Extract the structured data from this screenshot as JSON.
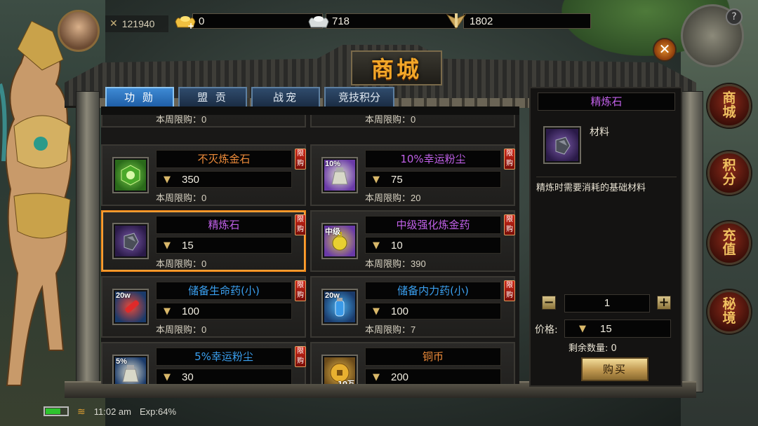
{
  "player": {
    "power": "121940"
  },
  "currencies": [
    {
      "icon": "gold-ingot-icon",
      "value": "0"
    },
    {
      "icon": "silver-ingot-icon",
      "value": "718"
    },
    {
      "icon": "trophy-icon",
      "value": "1802"
    }
  ],
  "window": {
    "title": "商城"
  },
  "side_buttons": [
    "商城",
    "积分",
    "充值",
    "秘境"
  ],
  "tabs": [
    {
      "label": "功 勋",
      "active": true
    },
    {
      "label": "盟 贡",
      "active": false
    },
    {
      "label": "战宠",
      "active": false
    },
    {
      "label": "竞技积分",
      "active": false
    }
  ],
  "limit_badge": "限购",
  "weekly_label": "本周限购：",
  "items": [
    {
      "name": "",
      "price": "",
      "weekly": "0",
      "partial": true
    },
    {
      "name": "",
      "price": "",
      "weekly": "0",
      "partial": true
    },
    {
      "name": "不灭炼金石",
      "price": "350",
      "weekly": "0",
      "color": "orange",
      "icon": "alchemy-stone-icon",
      "tag": ""
    },
    {
      "name": "10%幸运粉尘",
      "price": "75",
      "weekly": "20",
      "color": "purple",
      "icon": "luck-dust-icon",
      "tag": "10%"
    },
    {
      "name": "精炼石",
      "price": "15",
      "weekly": "0",
      "color": "purple",
      "icon": "refining-stone-icon",
      "tag": "",
      "selected": true
    },
    {
      "name": "中级强化炼金药",
      "price": "10",
      "weekly": "390",
      "color": "purple",
      "icon": "potion-flask-icon",
      "tag": "中级"
    },
    {
      "name": "储备生命药(小)",
      "price": "100",
      "weekly": "0",
      "color": "blue",
      "icon": "health-potion-icon",
      "tag": "20w"
    },
    {
      "name": "储备内力药(小)",
      "price": "100",
      "weekly": "7",
      "color": "blue",
      "icon": "mana-potion-icon",
      "tag": "20w"
    },
    {
      "name": "5%幸运粉尘",
      "price": "30",
      "weekly": "",
      "color": "blue",
      "icon": "luck-dust-icon",
      "tag": "5%"
    },
    {
      "name": "铜币",
      "price": "200",
      "weekly": "",
      "color": "orange",
      "icon": "copper-coin-icon",
      "tag_b": "10万"
    }
  ],
  "detail": {
    "title": "精炼石",
    "type": "材料",
    "description": "精炼时需要消耗的基础材料",
    "quantity": "1",
    "price_label": "价格:",
    "price": "15",
    "remaining_label": "剩余数量:",
    "remaining": "0",
    "buy_label": "购买"
  },
  "status_bar": {
    "time": "11:02 am",
    "exp": "Exp:64%",
    "battery_level": 0.7
  },
  "colors": {
    "orange": "#ef8c3a",
    "purple": "#c060e8",
    "blue": "#3aa0f0",
    "tab_active": "#3e8ad4",
    "select_border": "#f08a1c"
  }
}
